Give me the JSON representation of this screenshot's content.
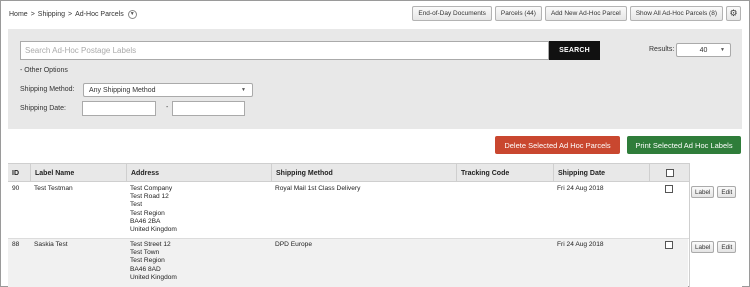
{
  "breadcrumb": {
    "items": [
      "Home",
      "Shipping",
      "Ad-Hoc Parcels"
    ],
    "separator": ">",
    "dropdown_icon": "chevron-down-icon"
  },
  "toolbar": {
    "end_of_day": "End-of-Day Documents",
    "parcels": "Parcels (44)",
    "add_new": "Add New Ad-Hoc Parcel",
    "show_all": "Show All Ad-Hoc Parcels (8)",
    "settings_icon": "gear-icon"
  },
  "search": {
    "placeholder": "Search Ad-Hoc Postage Labels",
    "button": "SEARCH",
    "value": ""
  },
  "results": {
    "label": "Results:",
    "value": "40"
  },
  "other_options": "- Other Options",
  "shipping_method": {
    "label": "Shipping Method:",
    "value": "Any Shipping Method"
  },
  "shipping_date": {
    "label": "Shipping Date:",
    "from": "",
    "to": "",
    "separator": "-"
  },
  "actions": {
    "delete_selected": "Delete Selected Ad Hoc Parcels",
    "print_selected": "Print Selected Ad Hoc Labels"
  },
  "table": {
    "columns": [
      "ID",
      "Label Name",
      "Address",
      "Shipping Method",
      "Tracking Code",
      "Shipping Date"
    ],
    "rows": [
      {
        "id": "90",
        "label_name": "Test Testman",
        "address": [
          "Test Company",
          "Test Road 12",
          "Test",
          "Test Region",
          "BA46 2BA",
          "United Kingdom"
        ],
        "shipping_method": "Royal Mail 1st Class Delivery",
        "tracking_code": "",
        "shipping_date": "Fri 24 Aug 2018",
        "label_btn": "Label",
        "edit_btn": "Edit"
      },
      {
        "id": "88",
        "label_name": "Saskia Test",
        "address": [
          "Test Street 12",
          "Test Town",
          "Test Region",
          "BA46 8AD",
          "United Kingdom"
        ],
        "shipping_method": "DPD Europe",
        "tracking_code": "",
        "shipping_date": "Fri 24 Aug 2018",
        "label_btn": "Label",
        "edit_btn": "Edit"
      }
    ]
  },
  "colors": {
    "delete": "#c9472f",
    "print": "#2f7d3a",
    "search_button": "#111111",
    "panel": "#e8e8e8"
  }
}
